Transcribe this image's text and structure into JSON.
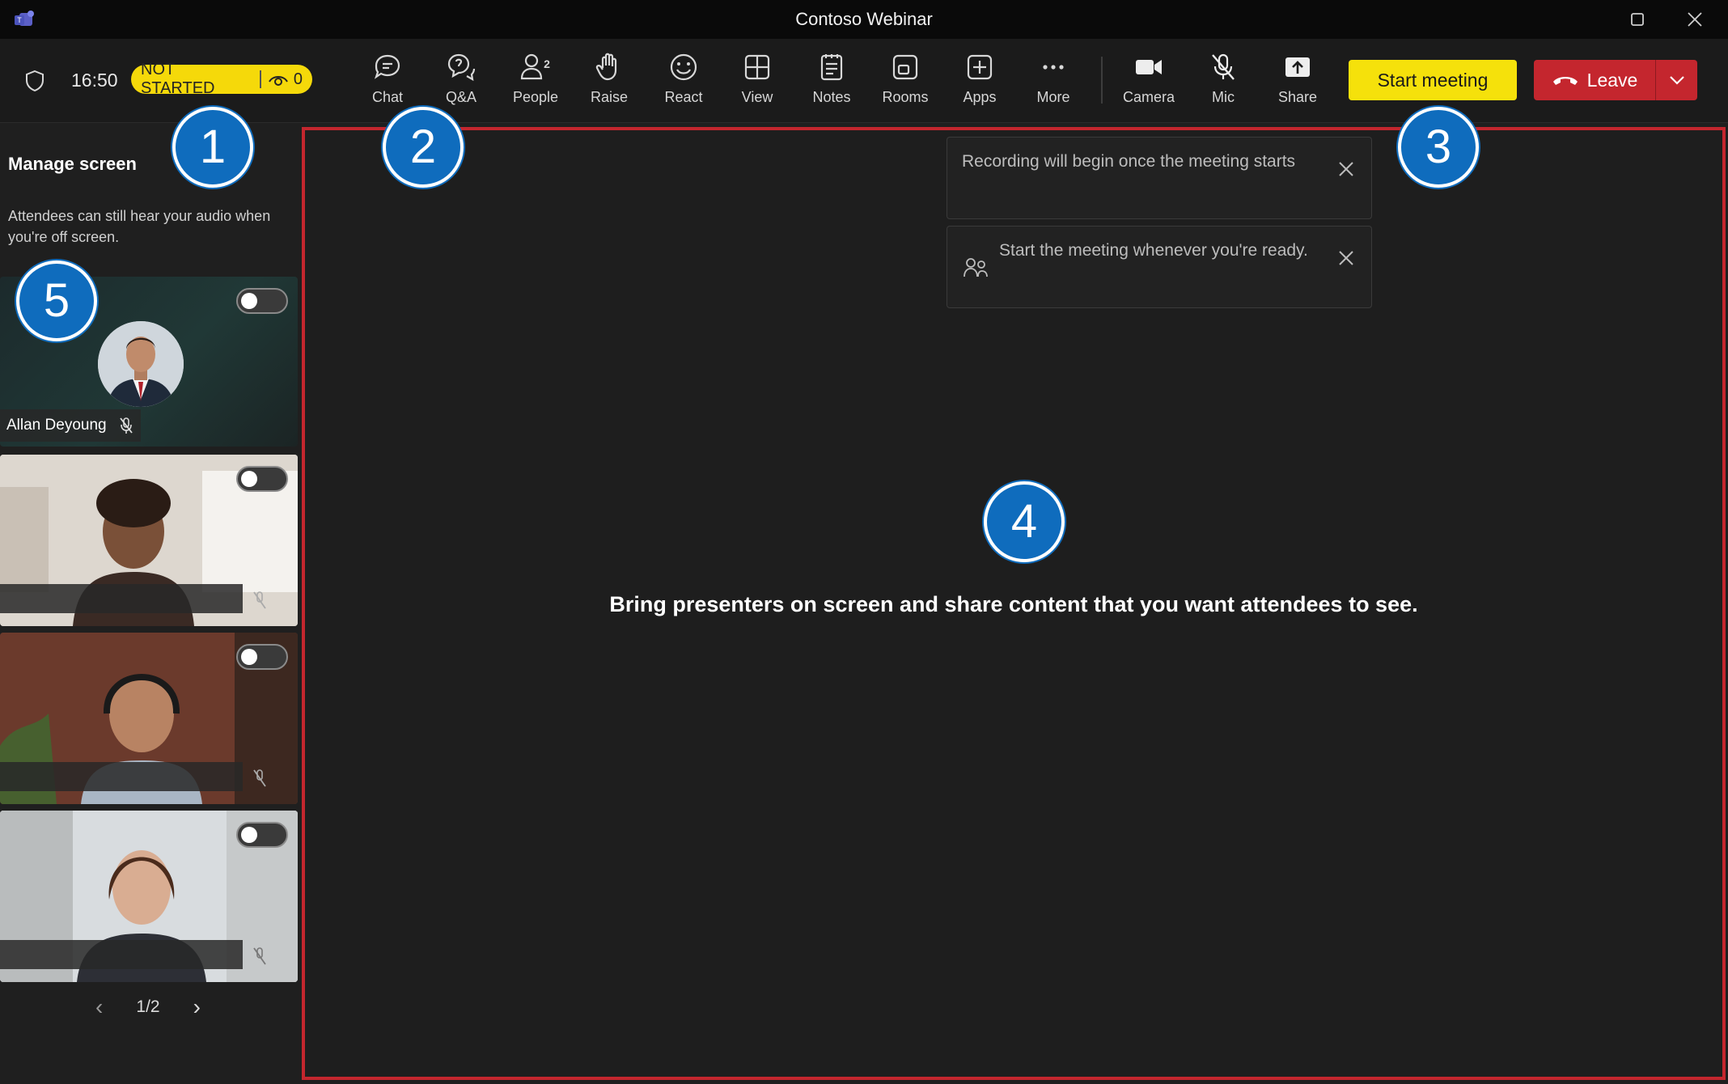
{
  "window": {
    "title": "Contoso Webinar",
    "controls": [
      "maximize-icon",
      "close-icon"
    ]
  },
  "toolbar": {
    "time": "16:50",
    "status": "NOT STARTED",
    "viewer_count": "0",
    "buttons": [
      {
        "label": "Chat",
        "icon": "chat-icon"
      },
      {
        "label": "Q&A",
        "icon": "qa-icon"
      },
      {
        "label": "People",
        "icon": "people-icon",
        "count": "2"
      },
      {
        "label": "Raise",
        "icon": "raise-hand-icon"
      },
      {
        "label": "React",
        "icon": "react-icon"
      },
      {
        "label": "View",
        "icon": "view-icon"
      },
      {
        "label": "Notes",
        "icon": "notes-icon"
      },
      {
        "label": "Rooms",
        "icon": "rooms-icon"
      },
      {
        "label": "Apps",
        "icon": "apps-icon"
      },
      {
        "label": "More",
        "icon": "more-icon"
      },
      {
        "label": "Camera",
        "icon": "camera-icon"
      },
      {
        "label": "Mic",
        "icon": "mic-off-icon"
      },
      {
        "label": "Share",
        "icon": "share-icon"
      }
    ],
    "start_label": "Start meeting",
    "leave_label": "Leave"
  },
  "left_panel": {
    "title": "Manage screen",
    "description": "Attendees can still hear your audio when you're off screen.",
    "participants": [
      {
        "name": "Allan Deyoung",
        "on_screen": false
      },
      {
        "name": "",
        "on_screen": false
      },
      {
        "name": "",
        "on_screen": false
      },
      {
        "name": "",
        "on_screen": false
      }
    ],
    "page": "1/2"
  },
  "stage": {
    "toasts": [
      {
        "text": "Recording will begin once the meeting starts"
      },
      {
        "text": "Start the meeting whenever you're ready."
      }
    ],
    "message": "Bring presenters on screen and share content that you want attendees to see."
  },
  "badges": [
    "1",
    "2",
    "3",
    "4",
    "5"
  ],
  "colors": {
    "accent_yellow": "#f5e10b",
    "leave_red": "#c4262e",
    "badge_blue": "#0f6cbd",
    "stage_border": "#c4262e"
  }
}
